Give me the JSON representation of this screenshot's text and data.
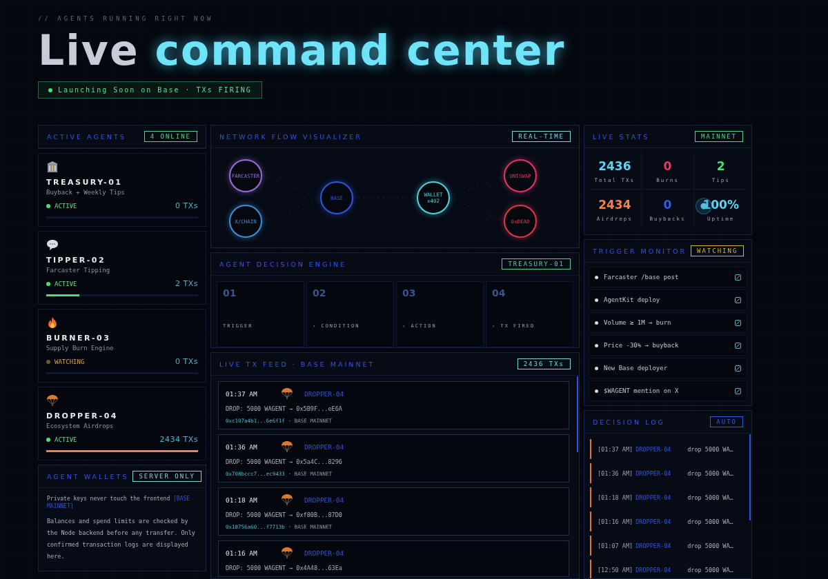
{
  "header": {
    "kicker": "// AGENTS RUNNING RIGHT NOW",
    "title_lead": "Live",
    "title_accent": "command center",
    "status_badge": "Launching Soon on Base · TXs FIRING"
  },
  "active_agents": {
    "title": "ACTIVE AGENTS",
    "badge": "4 ONLINE",
    "agents": [
      {
        "kind": "bank",
        "name": "TREASURY-01",
        "description": "Buyback + Weekly Tips",
        "active": true,
        "status_label": "ACTIVE",
        "txs": "0 TXs",
        "level": 0
      },
      {
        "kind": "chat",
        "name": "TIPPER-02",
        "description": "Farcaster Tipping",
        "active": true,
        "status_label": "ACTIVE",
        "txs": "2 TXs",
        "level": 0.22,
        "color": "#4ade80"
      },
      {
        "kind": "fire",
        "name": "BURNER-03",
        "description": "Supply Burn Engine",
        "active": false,
        "status_label": "WATCHING",
        "txs": "0 TXs",
        "level": 0
      },
      {
        "kind": "parachute",
        "name": "DROPPER-04",
        "description": "Ecosystem Airdrops",
        "active": true,
        "status_label": "ACTIVE",
        "txs": "2434 TXs",
        "level": 1,
        "color": "#f2824a"
      }
    ]
  },
  "agent_wallets": {
    "title": "AGENT WALLETS",
    "badge": "SERVER ONLY",
    "note": "Private keys never touch the frontend",
    "note_tag": "[BASE MAINNET]",
    "body": "Balances and spend limits are checked by the Node backend before any transfer. Only confirmed transaction logs are displayed here."
  },
  "network_flow": {
    "title": "NETWORK FLOW VISUALIZER",
    "badge": "REAL-TIME",
    "nodes": [
      {
        "label": "FARCASTER",
        "color": "#9b6bd6"
      },
      {
        "label": "X/CHAIN",
        "color": "#3f8fd8"
      },
      {
        "label": "BASE",
        "color": "#2f55e0"
      },
      {
        "label": "WALLET x402",
        "color": "#4fd1d9"
      },
      {
        "label": "UNISWAP",
        "color": "#e0366a"
      },
      {
        "label": "0xDEAD",
        "color": "#e0364a"
      }
    ]
  },
  "decision_engine": {
    "title": "AGENT DECISION ENGINE",
    "badge": "TREASURY-01",
    "steps": [
      {
        "number": "01",
        "label": "TRIGGER"
      },
      {
        "number": "02",
        "label": "› CONDITION"
      },
      {
        "number": "03",
        "label": "› ACTION"
      },
      {
        "number": "04",
        "label": "› TX FIRED"
      }
    ]
  },
  "tx_feed": {
    "title": "LIVE TX FEED · BASE MAINNET",
    "badge": "2436 TXs",
    "items": [
      {
        "time": "01:37 AM",
        "agent": "DROPPER-04",
        "action": "DROP: 5000 WAGENT → 0x5B9F...eE6A",
        "hash": "0xc107a4b1...6e6f1f",
        "network": "· BASE MAINNET"
      },
      {
        "time": "01:36 AM",
        "agent": "DROPPER-04",
        "action": "DROP: 5000 WAGENT → 0x5a4C...8296",
        "hash": "0x708bccc7...ec9433",
        "network": "· BASE MAINNET"
      },
      {
        "time": "01:18 AM",
        "agent": "DROPPER-04",
        "action": "DROP: 5000 WAGENT → 0xf80B...87D0",
        "hash": "0x18756a60...f7713b",
        "network": "· BASE MAINNET"
      },
      {
        "time": "01:16 AM",
        "agent": "DROPPER-04",
        "action": "DROP: 5000 WAGENT → 0x4A48...63Ea"
      }
    ]
  },
  "live_stats": {
    "title": "LIVE STATS",
    "badge": "MAINNET",
    "stats": [
      {
        "value": "2436",
        "label": "Total TXs",
        "color": "#5fd3f3"
      },
      {
        "value": "0",
        "label": "Burns",
        "color": "#f0365a"
      },
      {
        "value": "2",
        "label": "Tips",
        "color": "#4ade80"
      },
      {
        "value": "2434",
        "label": "Airdrops",
        "color": "#f2824a"
      },
      {
        "value": "0",
        "label": "Buybacks",
        "color": "#2f5cf0"
      },
      {
        "value": "100%",
        "label": "Uptime",
        "color": "#5fd3f3"
      }
    ]
  },
  "trigger_monitor": {
    "title": "TRIGGER MONITOR",
    "badge": "WATCHING",
    "triggers": [
      "Farcaster /base post",
      "AgentKit deploy",
      "Volume ≥ 1M → burn",
      "Price -30% → buyback",
      "New Base deployer",
      "$WAGENT mention on X"
    ]
  },
  "decision_log": {
    "title": "DECISION LOG",
    "badge": "AUTO",
    "entries": [
      {
        "time": "[01:37 AM]",
        "agent": "DROPPER-04",
        "message": "drop 5000 WA…"
      },
      {
        "time": "[01:36 AM]",
        "agent": "DROPPER-04",
        "message": "drop 5000 WA…"
      },
      {
        "time": "[01:18 AM]",
        "agent": "DROPPER-04",
        "message": "drop 5000 WA…"
      },
      {
        "time": "[01:16 AM]",
        "agent": "DROPPER-04",
        "message": "drop 5000 WA…"
      },
      {
        "time": "[01:07 AM]",
        "agent": "DROPPER-04",
        "message": "drop 5000 WA…"
      },
      {
        "time": "[12:50 AM]",
        "agent": "DROPPER-04",
        "message": "drop 5000 WA…"
      }
    ]
  }
}
